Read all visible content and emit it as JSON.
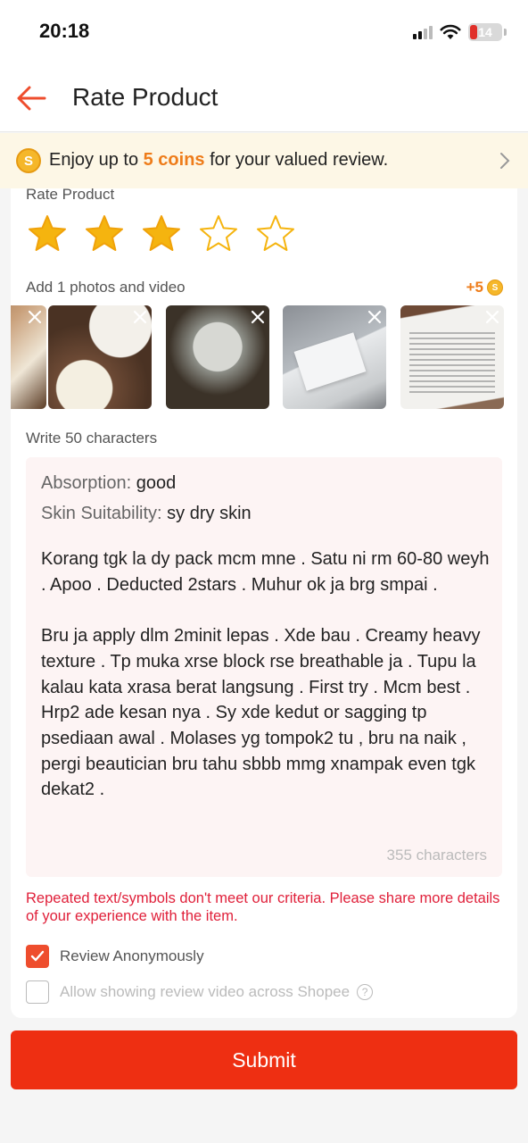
{
  "status_bar": {
    "time": "20:18",
    "battery": "14"
  },
  "header": {
    "title": "Rate Product"
  },
  "coin_banner": {
    "prefix": "Enjoy up to ",
    "highlight": "5 coins",
    "suffix": " for your valued review."
  },
  "rating": {
    "label": "Rate Product",
    "value": 3,
    "max": 5
  },
  "photos": {
    "label": "Add 1 photos and video",
    "bonus": "+5",
    "count": 5
  },
  "review": {
    "label": "Write 50 characters",
    "attr1_key": "Absorption: ",
    "attr1_value": "good",
    "attr2_key": "Skin Suitability: ",
    "attr2_value": "sy dry skin",
    "text": "Korang tgk la dy pack mcm mne . Satu ni rm 60-80 weyh . Apoo . Deducted 2stars . Muhur ok ja brg smpai .\n\nBru ja apply dlm 2minit lepas . Xde bau . Creamy heavy texture . Tp muka xrse block rse breathable ja . Tupu la kalau kata xrasa berat langsung . First try . Mcm best . Hrp2 ade kesan nya . Sy xde kedut or sagging tp psediaan awal . Molases yg tompok2 tu , bru na naik , pergi beautician bru tahu sbbb mmg xnampak even tgk dekat2 .",
    "char_count": "355 characters"
  },
  "error": "Repeated text/symbols don't meet our criteria. Please share more details of your experience with the item.",
  "options": {
    "anonymous_label": "Review Anonymously",
    "anonymous_checked": true,
    "video_label": "Allow showing review video across Shopee",
    "video_checked": false
  },
  "submit_label": "Submit",
  "colors": {
    "accent": "#ee4d2d",
    "star": "#f5b40f",
    "error": "#e0203a",
    "coin": "#ee7c1a"
  }
}
